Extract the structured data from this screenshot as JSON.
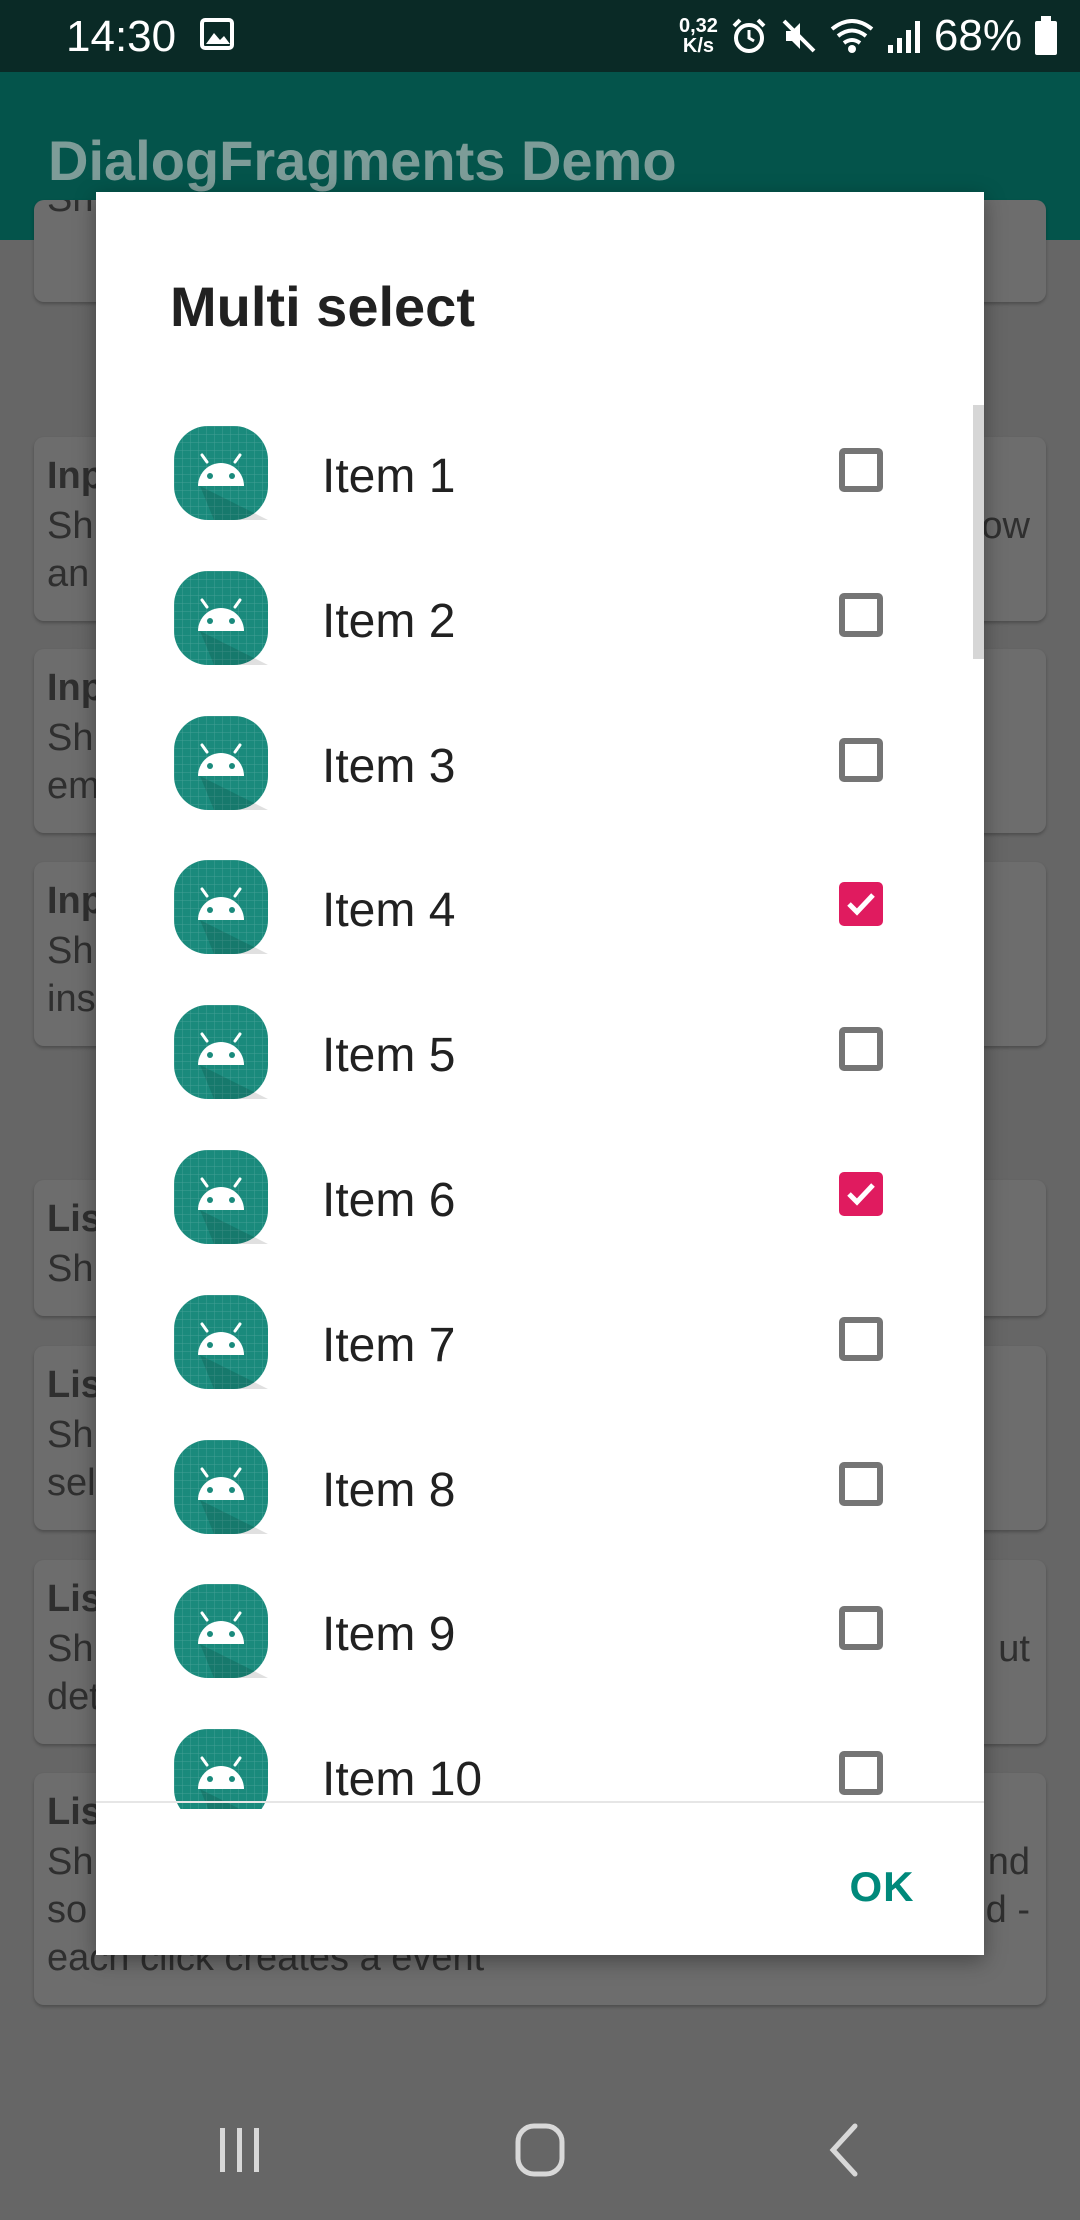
{
  "status_bar": {
    "time": "14:30",
    "net_speed_value": "0,32",
    "net_speed_unit": "K/s",
    "battery": "68%"
  },
  "app_bar": {
    "title": "DialogFragments Demo"
  },
  "background_cards": [
    {
      "title": "",
      "lines": [
        "Sh"
      ],
      "right": []
    },
    {
      "title": "Inp",
      "lines": [
        "Sh",
        "an"
      ],
      "right": [
        "ow"
      ]
    },
    {
      "title": "Inp",
      "lines": [
        "Sh",
        "em"
      ],
      "right": []
    },
    {
      "title": "Inp",
      "lines": [
        "Sh",
        "ins"
      ],
      "right": []
    },
    {
      "title": "Lis",
      "lines": [
        "Sh"
      ],
      "right": []
    },
    {
      "title": "Lis",
      "lines": [
        "Sh",
        "sel"
      ],
      "right": []
    },
    {
      "title": "Lis",
      "lines": [
        "Sh",
        "det"
      ],
      "right": [
        "ut"
      ]
    },
    {
      "title": "Lis",
      "lines": [
        "Sh",
        "so",
        "each click creates a event"
      ],
      "right": [
        "nd",
        "d -"
      ]
    }
  ],
  "dialog": {
    "title": "Multi select",
    "items": [
      {
        "label": "Item 1",
        "checked": false
      },
      {
        "label": "Item 2",
        "checked": false
      },
      {
        "label": "Item 3",
        "checked": false
      },
      {
        "label": "Item 4",
        "checked": true
      },
      {
        "label": "Item 5",
        "checked": false
      },
      {
        "label": "Item 6",
        "checked": true
      },
      {
        "label": "Item 7",
        "checked": false
      },
      {
        "label": "Item 8",
        "checked": false
      },
      {
        "label": "Item 9",
        "checked": false
      },
      {
        "label": "Item 10",
        "checked": false
      }
    ],
    "ok_label": "OK"
  },
  "colors": {
    "app_bar": "#04544b",
    "checkbox_checked": "#e01b5f",
    "ok_text": "#00897b",
    "icon_bg": "#1a8a7c"
  },
  "icons": {
    "item_icon": "android-app-icon",
    "nav_recents": "recents-icon",
    "nav_home": "home-icon",
    "nav_back": "back-icon"
  }
}
